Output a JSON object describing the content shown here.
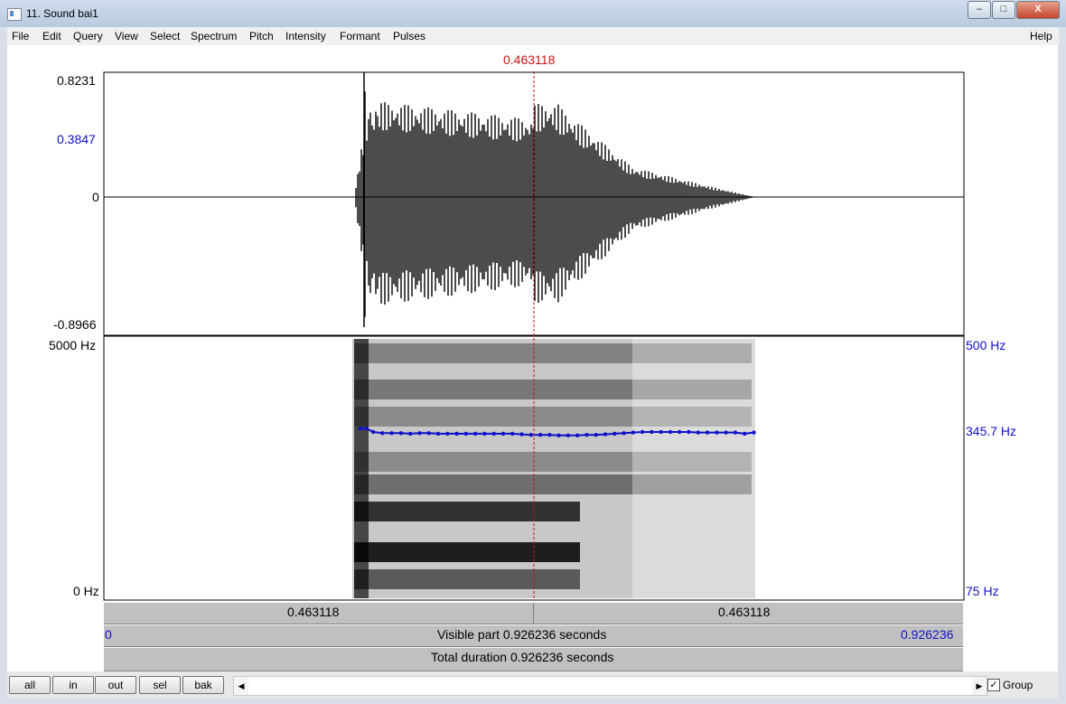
{
  "window": {
    "title": "11. Sound bai1",
    "minimize": "–",
    "maximize": "□",
    "close": "X"
  },
  "menu": [
    "File",
    "Edit",
    "Query",
    "View",
    "Select",
    "Spectrum",
    "Pitch",
    "Intensity",
    "Formant",
    "Pulses"
  ],
  "help": "Help",
  "cursor_time": "0.463118",
  "waveform": {
    "max": "0.8231",
    "marker": "0.3847",
    "zero": "0",
    "min": "-0.8966"
  },
  "spectrogram": {
    "freq_top": "5000 Hz",
    "freq_bottom": "0 Hz",
    "pitch_top": "500 Hz",
    "pitch_cursor": "345.7 Hz",
    "pitch_bottom": "75 Hz"
  },
  "pitch_track": {
    "t": [
      0.276,
      0.283,
      0.29,
      0.3,
      0.31,
      0.32,
      0.33,
      0.34,
      0.35,
      0.36,
      0.37,
      0.38,
      0.39,
      0.4,
      0.41,
      0.42,
      0.43,
      0.44,
      0.45,
      0.46,
      0.47,
      0.48,
      0.49,
      0.5,
      0.51,
      0.52,
      0.53,
      0.54,
      0.55,
      0.56,
      0.57,
      0.58,
      0.59,
      0.6,
      0.61,
      0.62,
      0.63,
      0.64,
      0.65,
      0.66,
      0.67,
      0.68,
      0.69,
      0.7
    ],
    "hz": [
      356,
      356,
      350,
      348,
      348,
      348,
      347,
      348,
      348,
      347,
      347,
      347,
      347,
      347,
      347,
      347,
      347,
      347,
      346,
      345,
      345,
      345,
      344,
      344,
      344,
      345,
      345,
      346,
      347,
      348,
      349,
      350,
      350,
      350,
      350,
      350,
      350,
      349,
      349,
      349,
      349,
      349,
      347,
      349
    ]
  },
  "time_bar": {
    "left": "0.463118",
    "right": "0.463118"
  },
  "visible_bar": {
    "start": "0",
    "text": "Visible part 0.926236 seconds",
    "end": "0.926236"
  },
  "total_bar": {
    "text": "Total duration 0.926236 seconds"
  },
  "buttons": [
    "all",
    "in",
    "out",
    "sel",
    "bak"
  ],
  "scroll": {
    "left_arrow": "◀",
    "right_arrow": "▶"
  },
  "group": {
    "label": "Group",
    "checked": "✓"
  },
  "colors": {
    "cursor": "#cc1010",
    "pitch": "#1010c8"
  }
}
